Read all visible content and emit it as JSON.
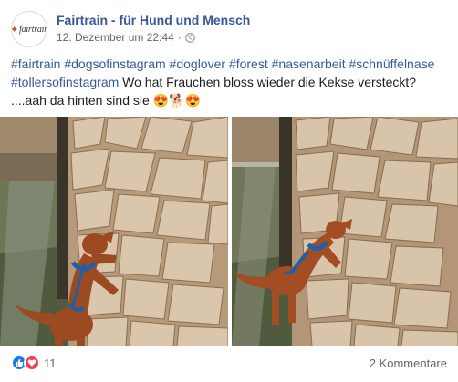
{
  "post": {
    "page_name": "Fairtrain - für Hund und Mensch",
    "avatar_logo_text": "fairtrain",
    "timestamp": "12. Dezember um 22:44",
    "separator": "·",
    "privacy_icon": "globe-icon",
    "more_icon": "more-options-icon",
    "text_tags": [
      "#fairtrain",
      "#dogsofinstagram",
      "#doglover",
      "#forest",
      "#nasenarbeit",
      "#schnüffelnase",
      "#tollersofinstagram"
    ],
    "text_body": "Wo hat Frauchen bloss wieder die Kekse versteckt? ....aah da hinten sind sie",
    "text_emojis": "😍🐕😍"
  },
  "photos": [
    {
      "name": "dog-woodpile-photo-1"
    },
    {
      "name": "dog-woodpile-photo-2"
    }
  ],
  "footer": {
    "reaction_icons": [
      "like-icon",
      "love-icon"
    ],
    "reaction_count": "11",
    "comments": "2 Kommentare"
  },
  "colors": {
    "link": "#385898",
    "like": "#1877f2",
    "love": "#f33e58",
    "meta": "#616770"
  }
}
